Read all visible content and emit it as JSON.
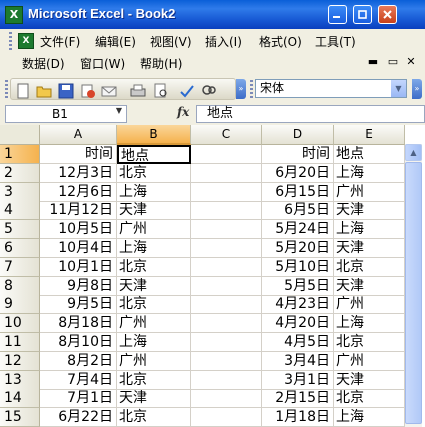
{
  "window": {
    "title": "Microsoft Excel - Book2",
    "icon": "excel-app-icon"
  },
  "menu": {
    "row1": [
      "文件(F)",
      "编辑(E)",
      "视图(V)",
      "插入(I)",
      "格式(O)",
      "工具(T)"
    ],
    "row2": [
      "数据(D)",
      "窗口(W)",
      "帮助(H)"
    ]
  },
  "toolbar": {
    "icons": [
      "new-icon",
      "open-icon",
      "save-icon",
      "permission-icon",
      "email-icon",
      "print-icon",
      "print-preview-icon",
      "spelling-icon"
    ],
    "font_name": "宋体"
  },
  "formula_bar": {
    "name_box": "B1",
    "fx_label": "fx",
    "formula": "地点"
  },
  "sheet": {
    "columns": [
      "A",
      "B",
      "C",
      "D",
      "E"
    ],
    "selected_column": "B",
    "selected_row": "1",
    "rows": [
      {
        "n": "1",
        "a": "时间",
        "b": "地点",
        "c": "",
        "d": "时间",
        "e": "地点"
      },
      {
        "n": "2",
        "a": "12月3日",
        "b": "北京",
        "c": "",
        "d": "6月20日",
        "e": "上海"
      },
      {
        "n": "3",
        "a": "12月6日",
        "b": "上海",
        "c": "",
        "d": "6月15日",
        "e": "广州"
      },
      {
        "n": "4",
        "a": "11月12日",
        "b": "天津",
        "c": "",
        "d": "6月5日",
        "e": "天津"
      },
      {
        "n": "5",
        "a": "10月5日",
        "b": "广州",
        "c": "",
        "d": "5月24日",
        "e": "上海"
      },
      {
        "n": "6",
        "a": "10月4日",
        "b": "上海",
        "c": "",
        "d": "5月20日",
        "e": "天津"
      },
      {
        "n": "7",
        "a": "10月1日",
        "b": "北京",
        "c": "",
        "d": "5月10日",
        "e": "北京"
      },
      {
        "n": "8",
        "a": "9月8日",
        "b": "天津",
        "c": "",
        "d": "5月5日",
        "e": "天津"
      },
      {
        "n": "9",
        "a": "9月5日",
        "b": "北京",
        "c": "",
        "d": "4月23日",
        "e": "广州"
      },
      {
        "n": "10",
        "a": "8月18日",
        "b": "广州",
        "c": "",
        "d": "4月20日",
        "e": "上海"
      },
      {
        "n": "11",
        "a": "8月10日",
        "b": "上海",
        "c": "",
        "d": "4月5日",
        "e": "北京"
      },
      {
        "n": "12",
        "a": "8月2日",
        "b": "广州",
        "c": "",
        "d": "3月4日",
        "e": "广州"
      },
      {
        "n": "13",
        "a": "7月4日",
        "b": "北京",
        "c": "",
        "d": "3月1日",
        "e": "天津"
      },
      {
        "n": "14",
        "a": "7月1日",
        "b": "天津",
        "c": "",
        "d": "2月15日",
        "e": "北京"
      },
      {
        "n": "15",
        "a": "6月22日",
        "b": "北京",
        "c": "",
        "d": "1月18日",
        "e": "上海"
      }
    ]
  },
  "colors": {
    "title_bar": "#0a5fd8",
    "selected_header": "#f5b24e",
    "chrome": "#f1efe2"
  }
}
